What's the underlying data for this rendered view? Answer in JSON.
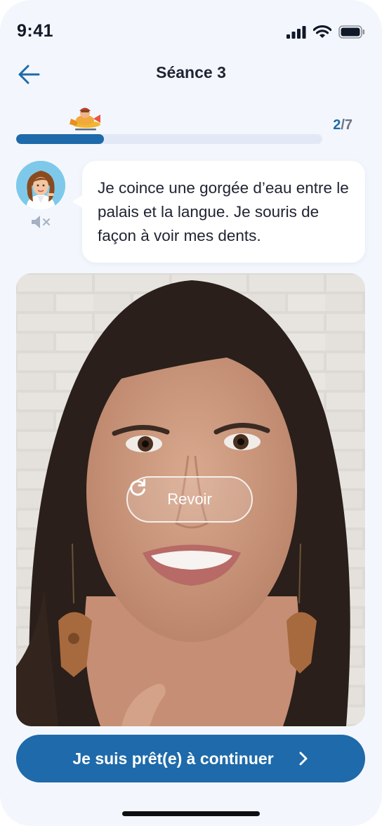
{
  "status_bar": {
    "time": "9:41"
  },
  "header": {
    "title": "Séance 3"
  },
  "progress": {
    "current": "2",
    "separator": "/",
    "total": "7",
    "fraction": 0.2857
  },
  "coach": {
    "message": "Je coince une gorgée d’eau entre le palais et la langue. Je souris de façon à voir mes dents."
  },
  "video": {
    "replay_label": "Revoir"
  },
  "cta": {
    "label": "Je suis prêt(e) à continuer"
  },
  "icons": {
    "back": "arrow-left-icon",
    "signal": "cellular-signal-icon",
    "wifi": "wifi-icon",
    "battery": "battery-icon",
    "mascot": "airplane-mascot-icon",
    "mute": "speaker-muted-icon",
    "replay": "replay-icon",
    "next": "chevron-right-icon"
  },
  "colors": {
    "primary": "#1e6aaa",
    "background": "#f3f7fd",
    "track": "#e2e8f6",
    "text": "#202433"
  }
}
